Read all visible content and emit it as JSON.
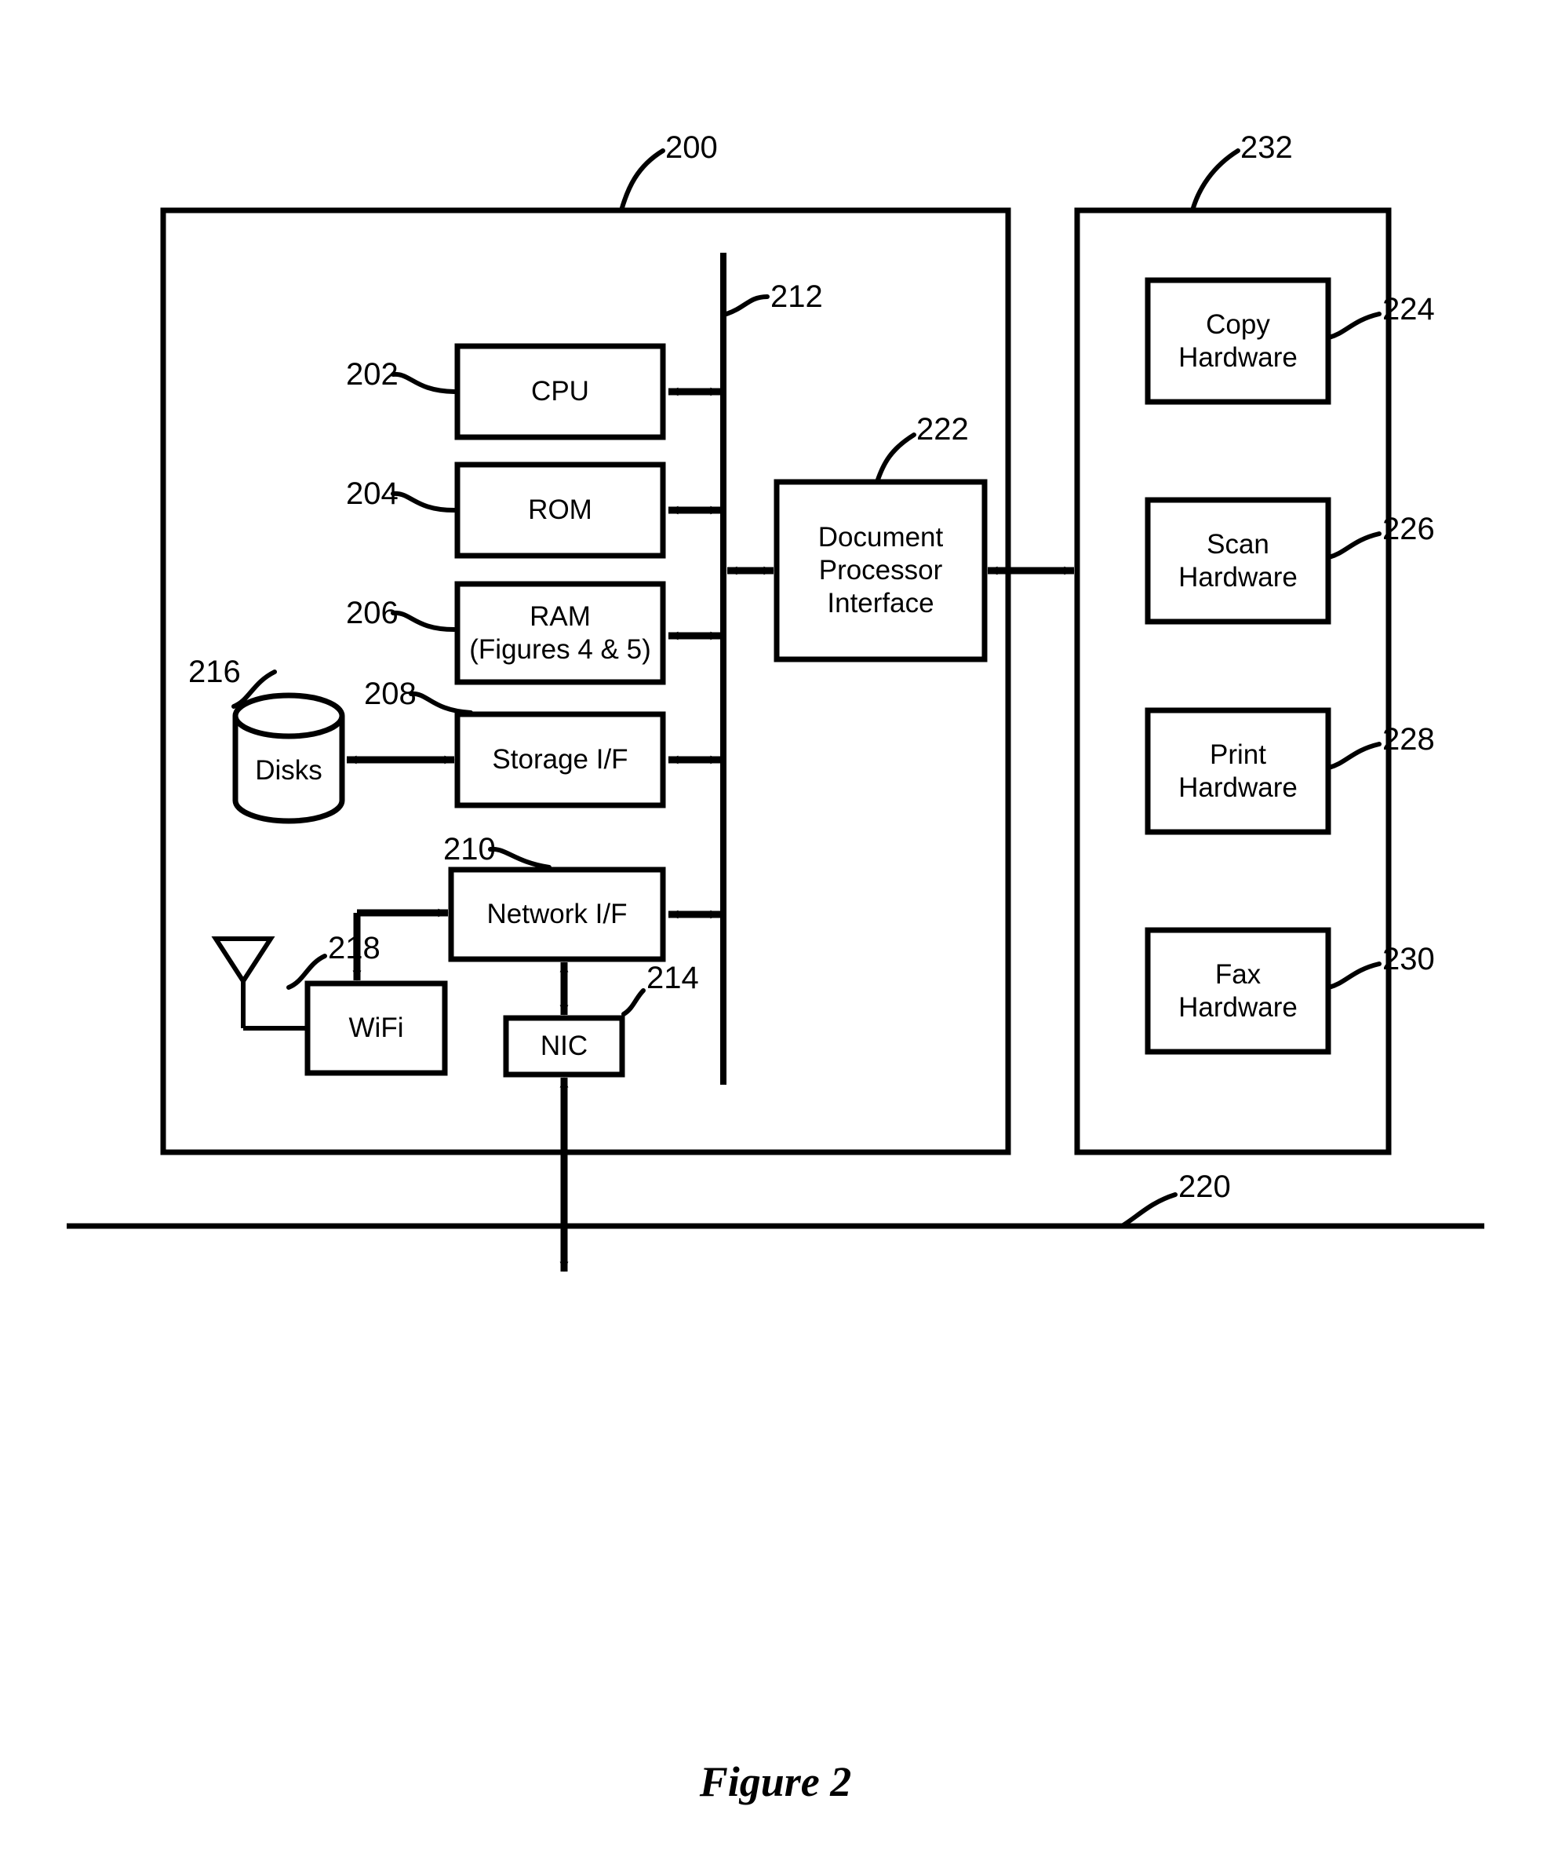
{
  "figure": {
    "caption": "Figure 2",
    "reference_numerals": {
      "system": "200",
      "cpu": "202",
      "rom": "204",
      "ram": "206",
      "storage_if": "208",
      "network_if": "210",
      "bus": "212",
      "nic": "214",
      "disks": "216",
      "wifi": "218",
      "network_line": "220",
      "document_processor_interface": "222",
      "copy_hardware": "224",
      "scan_hardware": "226",
      "print_hardware": "228",
      "fax_hardware": "230",
      "document_processor": "232"
    }
  },
  "controller": {
    "blocks": [
      {
        "id": "cpu",
        "label": "CPU",
        "ref": "202"
      },
      {
        "id": "rom",
        "label": "ROM",
        "ref": "204"
      },
      {
        "id": "ram",
        "label_line1": "RAM",
        "label_line2": "(Figures 4 & 5)",
        "ref": "206"
      },
      {
        "id": "storage_if",
        "label": "Storage I/F",
        "ref": "208"
      },
      {
        "id": "network_if",
        "label": "Network I/F",
        "ref": "210"
      },
      {
        "id": "nic",
        "label": "NIC",
        "ref": "214"
      },
      {
        "id": "wifi",
        "label": "WiFi",
        "ref": "218"
      },
      {
        "id": "disks",
        "label": "Disks",
        "ref": "216"
      },
      {
        "id": "dpi",
        "label_line1": "Document",
        "label_line2": "Processor",
        "label_line3": "Interface",
        "ref": "222"
      }
    ],
    "bus_ref": "212",
    "enclosure_ref": "200"
  },
  "document_processor": {
    "enclosure_ref": "232",
    "blocks": [
      {
        "id": "copy",
        "label_line1": "Copy",
        "label_line2": "Hardware",
        "ref": "224"
      },
      {
        "id": "scan",
        "label_line1": "Scan",
        "label_line2": "Hardware",
        "ref": "226"
      },
      {
        "id": "print",
        "label_line1": "Print",
        "label_line2": "Hardware",
        "ref": "228"
      },
      {
        "id": "fax",
        "label_line1": "Fax",
        "label_line2": "Hardware",
        "ref": "230"
      }
    ]
  },
  "network": {
    "ref": "220"
  },
  "colors": {
    "stroke": "#000000",
    "background": "#ffffff"
  }
}
